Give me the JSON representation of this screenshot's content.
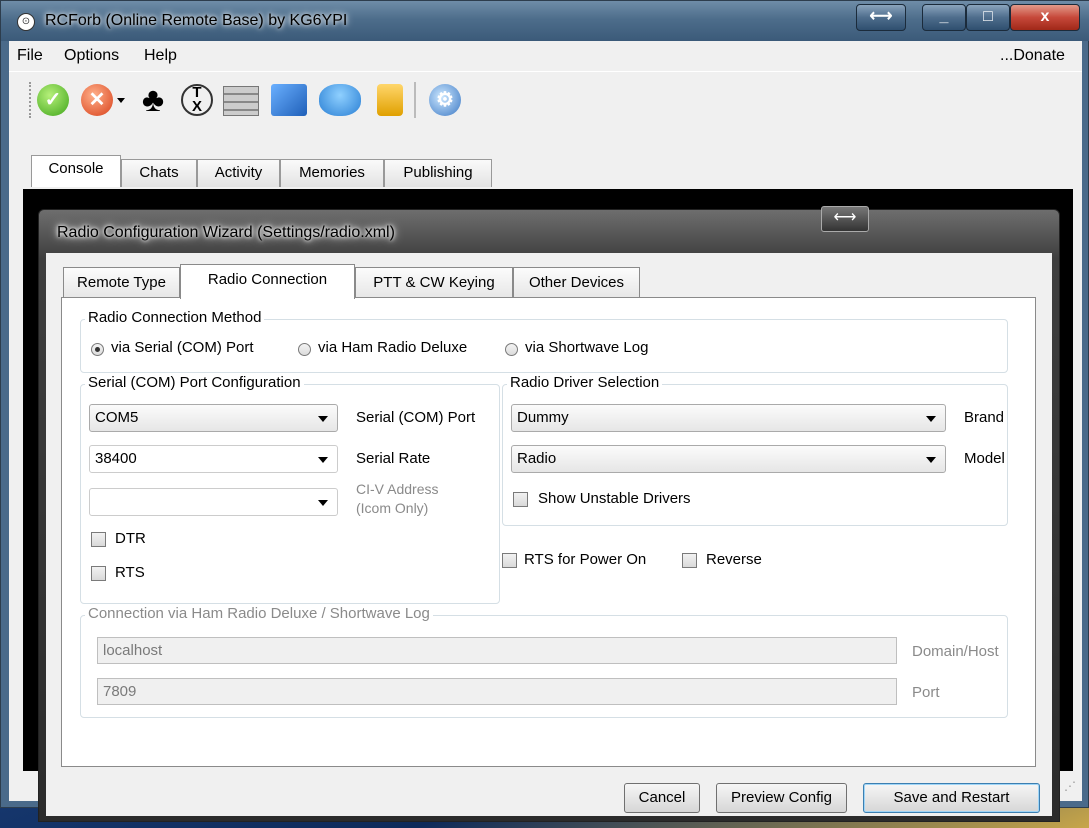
{
  "window": {
    "title": "RCForb (Online Remote Base) by KG6YPI",
    "controls": {
      "resize": "⟷",
      "minimize": "_",
      "maximize": "□",
      "close": "x"
    }
  },
  "menu": {
    "items": [
      "File",
      "Options",
      "Help"
    ],
    "donate": "...Donate"
  },
  "toolbar": {
    "icons": [
      "connect-check-icon",
      "disconnect-x-icon",
      "dropdown-arrow-icon",
      "club-card-icon",
      "tx-speech-icon",
      "rack-device-icon",
      "network-computers-icon",
      "users-group-icon",
      "lock-icon",
      "settings-gear-icon"
    ]
  },
  "main_tabs": [
    "Console",
    "Chats",
    "Activity",
    "Memories",
    "Publishing"
  ],
  "dialog": {
    "title": "Radio Configuration Wizard (Settings/radio.xml)",
    "resize": "⟷",
    "tabs": [
      "Remote Type",
      "Radio Connection",
      "PTT & CW Keying",
      "Other Devices"
    ],
    "active_tab": "Radio Connection",
    "connection_method": {
      "title": "Radio Connection Method",
      "options": [
        "via Serial (COM) Port",
        "via Ham Radio Deluxe",
        "via Shortwave Log"
      ],
      "selected": "via Serial (COM) Port"
    },
    "serial": {
      "title": "Serial (COM) Port Configuration",
      "port_value": "COM5",
      "port_label": "Serial (COM) Port",
      "rate_value": "38400",
      "rate_label": "Serial Rate",
      "civ_value": "",
      "civ_label_line1": "CI-V Address",
      "civ_label_line2": "(Icom Only)",
      "dtr_label": "DTR",
      "dtr_checked": false,
      "rts_label": "RTS",
      "rts_checked": false
    },
    "driver": {
      "title": "Radio Driver Selection",
      "brand_value": "Dummy",
      "brand_label": "Brand",
      "model_value": "Radio",
      "model_label": "Model",
      "unstable_label": "Show Unstable Drivers",
      "unstable_checked": false
    },
    "rts_power_on_label": "RTS for Power On",
    "reverse_label": "Reverse",
    "hrd": {
      "title": "Connection via Ham Radio Deluxe / Shortwave Log",
      "host_value": "localhost",
      "host_label": "Domain/Host",
      "port_value": "7809",
      "port_label": "Port"
    },
    "buttons": {
      "cancel": "Cancel",
      "preview": "Preview Config",
      "save": "Save and Restart"
    }
  }
}
